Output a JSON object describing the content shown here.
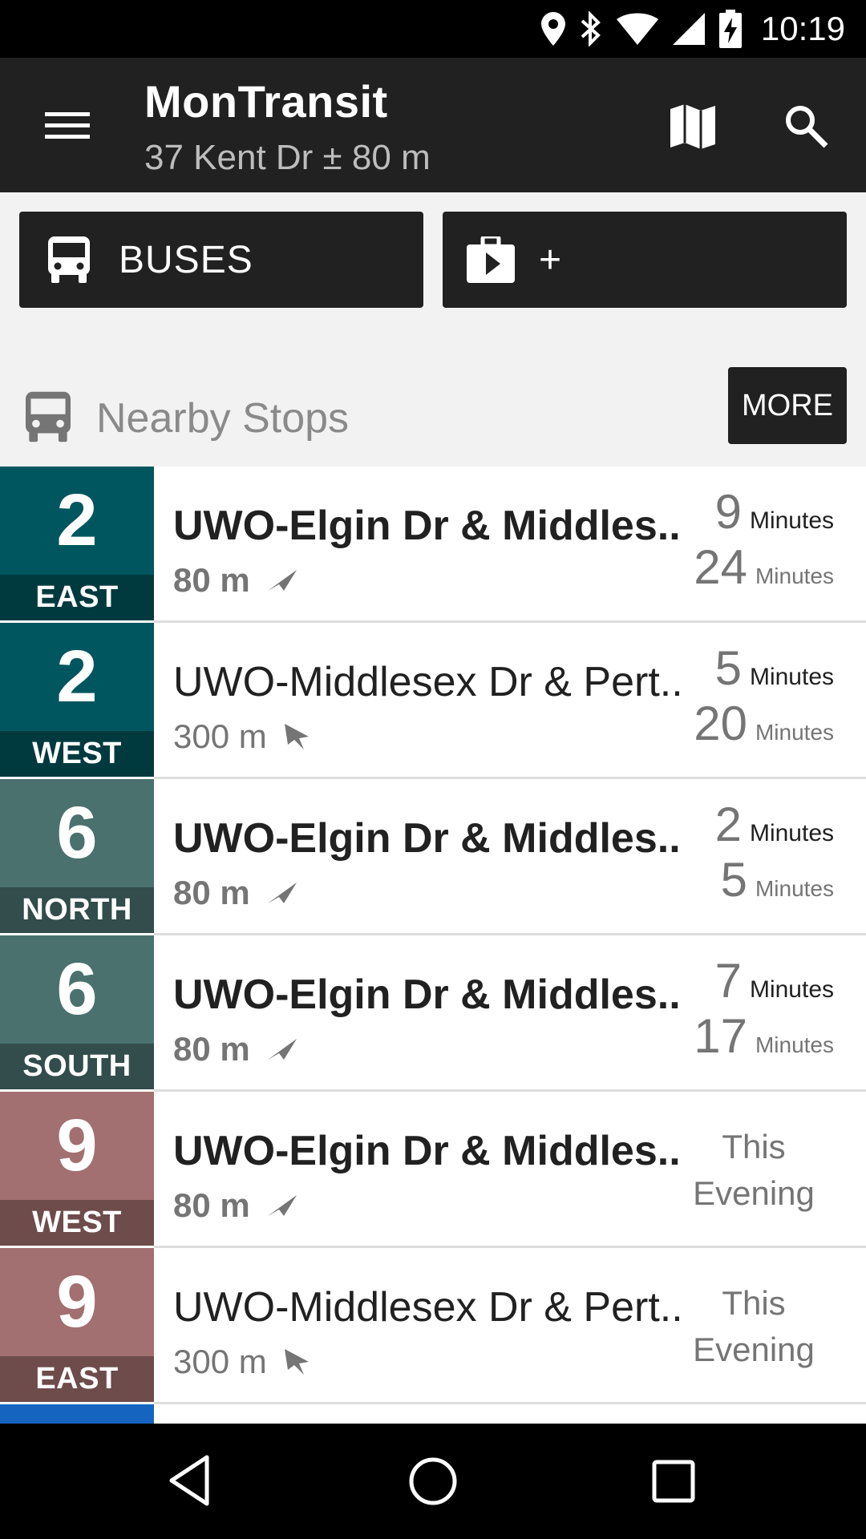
{
  "status_bar": {
    "time": "10:19",
    "icons": [
      "location-icon",
      "bluetooth-icon",
      "wifi-icon",
      "signal-icon",
      "battery-charging-icon"
    ]
  },
  "toolbar": {
    "title": "MonTransit",
    "subtitle": "37 Kent Dr ± 80 m",
    "icons": [
      "menu-icon",
      "map-icon",
      "search-icon"
    ]
  },
  "type_buttons": [
    {
      "label": "BUSES",
      "icon": "bus-icon"
    },
    {
      "label": "+",
      "icon": "add-agency-icon"
    }
  ],
  "nearby": {
    "title": "Nearby Stops",
    "more_label": "MORE",
    "icon": "bus-icon"
  },
  "stops": [
    {
      "route": "2",
      "direction": "EAST",
      "color": "#00565e",
      "dir_color": "#003a3f",
      "name": "UWO-Elgin Dr & Middles..",
      "bold": true,
      "distance": "80 m",
      "times": [
        {
          "value": "9",
          "unit": "Minutes"
        },
        {
          "value": "24",
          "unit": "Minutes"
        }
      ]
    },
    {
      "route": "2",
      "direction": "WEST",
      "color": "#00565e",
      "dir_color": "#003a3f",
      "name": "UWO-Middlesex Dr & Pert..",
      "bold": false,
      "distance": "300 m",
      "times": [
        {
          "value": "5",
          "unit": "Minutes"
        },
        {
          "value": "20",
          "unit": "Minutes"
        }
      ]
    },
    {
      "route": "6",
      "direction": "NORTH",
      "color": "#4a716e",
      "dir_color": "#324d4b",
      "name": "UWO-Elgin Dr & Middles..",
      "bold": true,
      "distance": "80 m",
      "times": [
        {
          "value": "2",
          "unit": "Minutes"
        },
        {
          "value": "5",
          "unit": "Minutes"
        }
      ]
    },
    {
      "route": "6",
      "direction": "SOUTH",
      "color": "#4a716e",
      "dir_color": "#324d4b",
      "name": "UWO-Elgin Dr & Middles..",
      "bold": true,
      "distance": "80 m",
      "times": [
        {
          "value": "7",
          "unit": "Minutes"
        },
        {
          "value": "17",
          "unit": "Minutes"
        }
      ]
    },
    {
      "route": "9",
      "direction": "WEST",
      "color": "#a27070",
      "dir_color": "#6e4c4c",
      "name": "UWO-Elgin Dr & Middles..",
      "bold": true,
      "distance": "80 m",
      "evening": [
        "This",
        "Evening"
      ]
    },
    {
      "route": "9",
      "direction": "EAST",
      "color": "#a27070",
      "dir_color": "#6e4c4c",
      "name": "UWO-Middlesex Dr & Pert..",
      "bold": false,
      "distance": "300 m",
      "evening": [
        "This",
        "Evening"
      ]
    }
  ],
  "nav_bar": {
    "icons": [
      "back-icon",
      "home-icon",
      "recents-icon"
    ]
  }
}
